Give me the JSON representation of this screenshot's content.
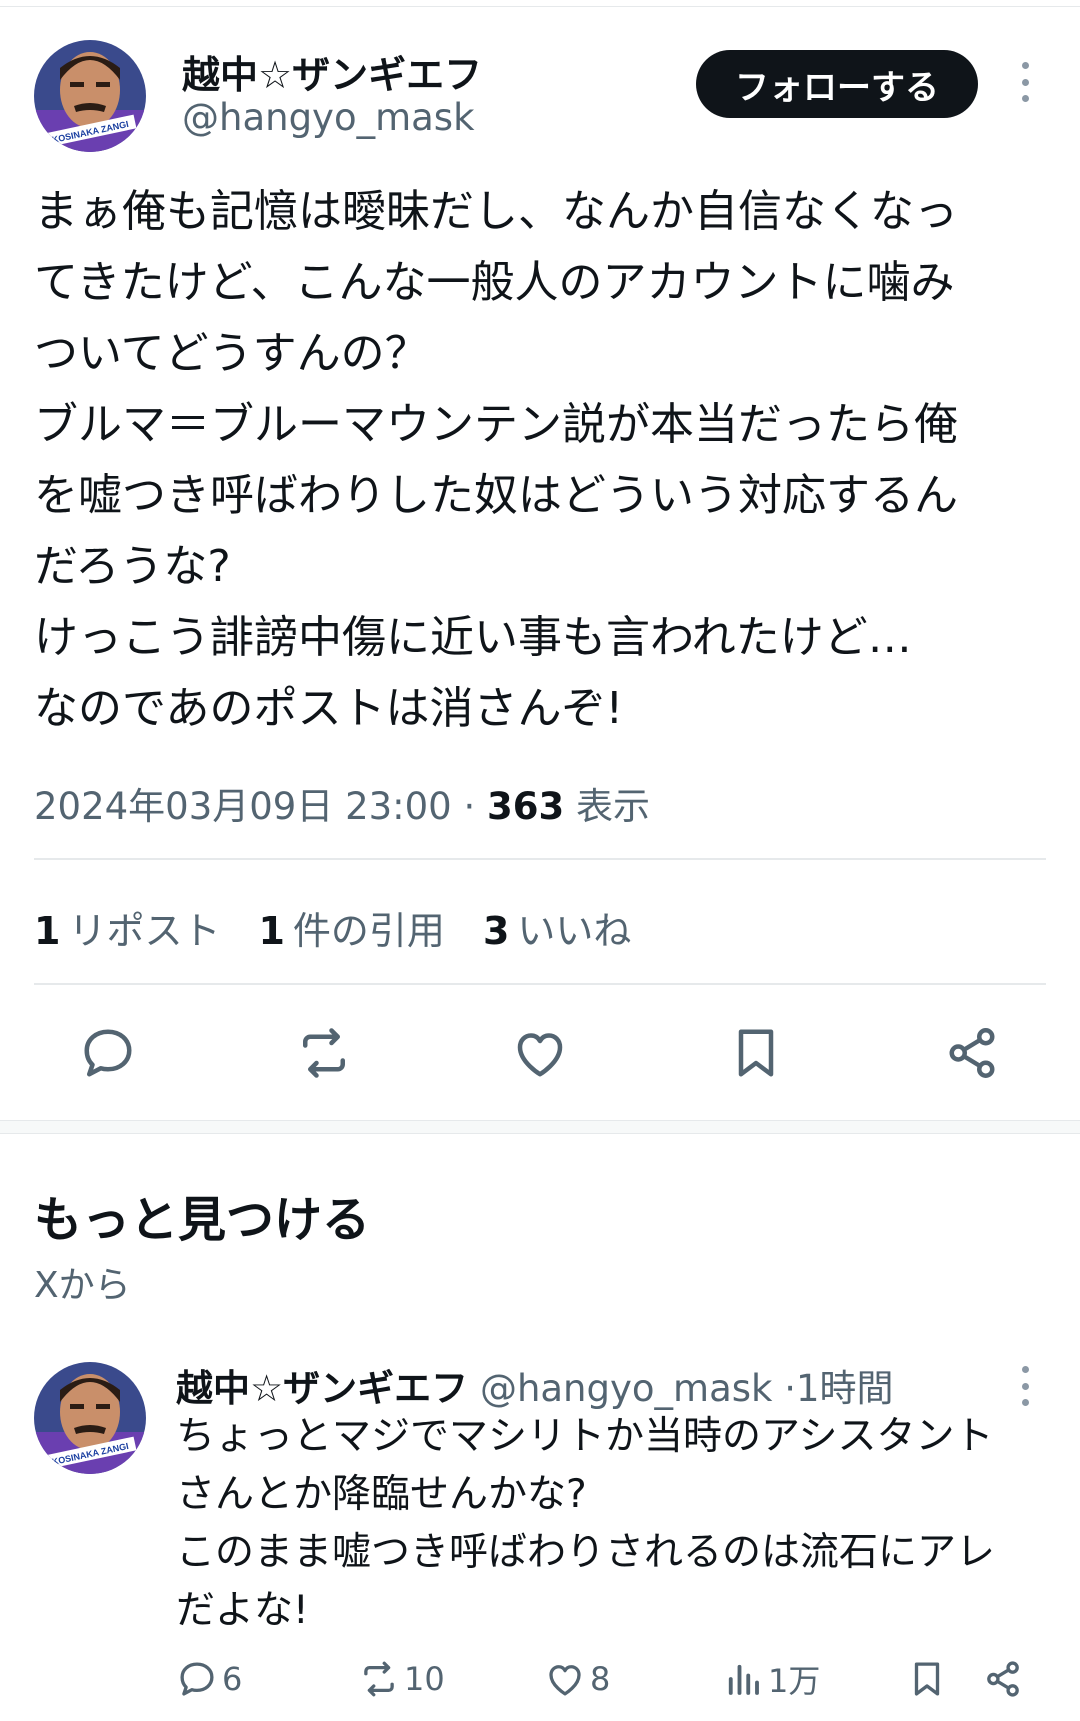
{
  "post": {
    "author_name": "越中☆ザンギエフ",
    "author_handle": "@hangyo_mask",
    "follow_label": "フォローする",
    "text_lines": [
      "まぁ俺も記憶は曖昧だし、なんか自信なくなっ",
      "てきたけど、こんな一般人のアカウントに噛み",
      "ついてどうすんの？",
      "ブルマ＝ブルーマウンテン説が本当だったら俺",
      "を嘘つき呼ばわりした奴はどういう対応するん",
      "だろうな?",
      "けっこう誹謗中傷に近い事も言われたけど…",
      "なのであのポストは消さんぞ!"
    ],
    "timestamp": "2024年03月09日 23:00",
    "meta_separator": "·",
    "views_count": "363",
    "views_label": "表示",
    "stats": {
      "reposts_count": "1",
      "reposts_label": "リポスト",
      "quotes_count": "1",
      "quotes_label": "件の引用",
      "likes_count": "3",
      "likes_label": "いいね"
    }
  },
  "more_section": {
    "title": "もっと見つける",
    "subtitle": "Xから"
  },
  "recommended_post": {
    "author_name": "越中☆ザンギエフ",
    "author_handle": "@hangyo_mask",
    "separator": "·",
    "time": "1時間",
    "text_lines": [
      "ちょっとマジでマシリトか当時のアシスタント",
      "さんとか降臨せんかな?",
      "このまま嘘つき呼ばわりされるのは流石にアレ",
      "だよな!"
    ],
    "replies": "6",
    "reposts": "10",
    "likes": "8",
    "views": "1万"
  },
  "avatar_text": "KOSINAKA ZANGI",
  "icons": [
    "reply-icon",
    "repost-icon",
    "like-icon",
    "bookmark-icon",
    "share-icon",
    "views-icon",
    "more-icon"
  ],
  "colors": {
    "text_primary": "#0f1419",
    "text_secondary": "#536471",
    "follow_button": "#0f1419",
    "divider": "#e6e9eb"
  }
}
